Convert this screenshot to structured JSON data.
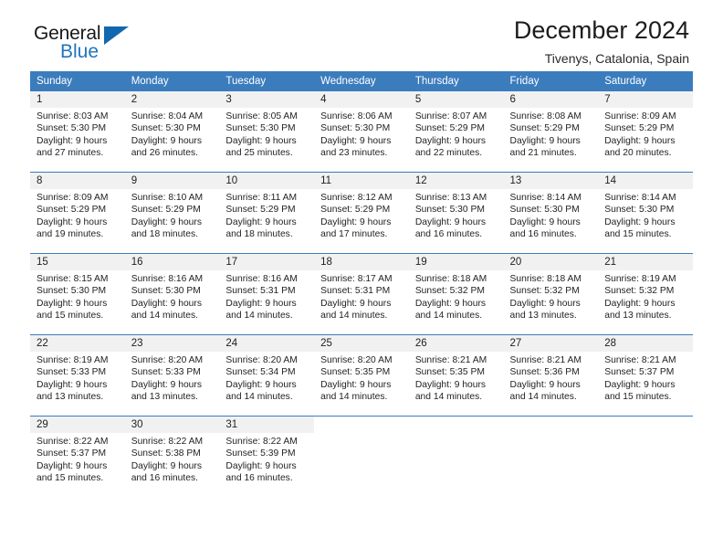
{
  "brand": {
    "name_part1": "General",
    "name_part2": "Blue",
    "triangle_color": "#1268ae",
    "blue_color": "#2175bb"
  },
  "header": {
    "title": "December 2024",
    "subtitle": "Tivenys, Catalonia, Spain"
  },
  "theme": {
    "header_row_bg": "#3b7cbd",
    "daynum_bg": "#f1f1f1",
    "text_color": "#232323"
  },
  "calendar": {
    "weekday_headers": [
      "Sunday",
      "Monday",
      "Tuesday",
      "Wednesday",
      "Thursday",
      "Friday",
      "Saturday"
    ],
    "weeks": [
      [
        {
          "day": "1",
          "sunrise": "Sunrise: 8:03 AM",
          "sunset": "Sunset: 5:30 PM",
          "daylight1": "Daylight: 9 hours",
          "daylight2": "and 27 minutes."
        },
        {
          "day": "2",
          "sunrise": "Sunrise: 8:04 AM",
          "sunset": "Sunset: 5:30 PM",
          "daylight1": "Daylight: 9 hours",
          "daylight2": "and 26 minutes."
        },
        {
          "day": "3",
          "sunrise": "Sunrise: 8:05 AM",
          "sunset": "Sunset: 5:30 PM",
          "daylight1": "Daylight: 9 hours",
          "daylight2": "and 25 minutes."
        },
        {
          "day": "4",
          "sunrise": "Sunrise: 8:06 AM",
          "sunset": "Sunset: 5:30 PM",
          "daylight1": "Daylight: 9 hours",
          "daylight2": "and 23 minutes."
        },
        {
          "day": "5",
          "sunrise": "Sunrise: 8:07 AM",
          "sunset": "Sunset: 5:29 PM",
          "daylight1": "Daylight: 9 hours",
          "daylight2": "and 22 minutes."
        },
        {
          "day": "6",
          "sunrise": "Sunrise: 8:08 AM",
          "sunset": "Sunset: 5:29 PM",
          "daylight1": "Daylight: 9 hours",
          "daylight2": "and 21 minutes."
        },
        {
          "day": "7",
          "sunrise": "Sunrise: 8:09 AM",
          "sunset": "Sunset: 5:29 PM",
          "daylight1": "Daylight: 9 hours",
          "daylight2": "and 20 minutes."
        }
      ],
      [
        {
          "day": "8",
          "sunrise": "Sunrise: 8:09 AM",
          "sunset": "Sunset: 5:29 PM",
          "daylight1": "Daylight: 9 hours",
          "daylight2": "and 19 minutes."
        },
        {
          "day": "9",
          "sunrise": "Sunrise: 8:10 AM",
          "sunset": "Sunset: 5:29 PM",
          "daylight1": "Daylight: 9 hours",
          "daylight2": "and 18 minutes."
        },
        {
          "day": "10",
          "sunrise": "Sunrise: 8:11 AM",
          "sunset": "Sunset: 5:29 PM",
          "daylight1": "Daylight: 9 hours",
          "daylight2": "and 18 minutes."
        },
        {
          "day": "11",
          "sunrise": "Sunrise: 8:12 AM",
          "sunset": "Sunset: 5:29 PM",
          "daylight1": "Daylight: 9 hours",
          "daylight2": "and 17 minutes."
        },
        {
          "day": "12",
          "sunrise": "Sunrise: 8:13 AM",
          "sunset": "Sunset: 5:30 PM",
          "daylight1": "Daylight: 9 hours",
          "daylight2": "and 16 minutes."
        },
        {
          "day": "13",
          "sunrise": "Sunrise: 8:14 AM",
          "sunset": "Sunset: 5:30 PM",
          "daylight1": "Daylight: 9 hours",
          "daylight2": "and 16 minutes."
        },
        {
          "day": "14",
          "sunrise": "Sunrise: 8:14 AM",
          "sunset": "Sunset: 5:30 PM",
          "daylight1": "Daylight: 9 hours",
          "daylight2": "and 15 minutes."
        }
      ],
      [
        {
          "day": "15",
          "sunrise": "Sunrise: 8:15 AM",
          "sunset": "Sunset: 5:30 PM",
          "daylight1": "Daylight: 9 hours",
          "daylight2": "and 15 minutes."
        },
        {
          "day": "16",
          "sunrise": "Sunrise: 8:16 AM",
          "sunset": "Sunset: 5:30 PM",
          "daylight1": "Daylight: 9 hours",
          "daylight2": "and 14 minutes."
        },
        {
          "day": "17",
          "sunrise": "Sunrise: 8:16 AM",
          "sunset": "Sunset: 5:31 PM",
          "daylight1": "Daylight: 9 hours",
          "daylight2": "and 14 minutes."
        },
        {
          "day": "18",
          "sunrise": "Sunrise: 8:17 AM",
          "sunset": "Sunset: 5:31 PM",
          "daylight1": "Daylight: 9 hours",
          "daylight2": "and 14 minutes."
        },
        {
          "day": "19",
          "sunrise": "Sunrise: 8:18 AM",
          "sunset": "Sunset: 5:32 PM",
          "daylight1": "Daylight: 9 hours",
          "daylight2": "and 14 minutes."
        },
        {
          "day": "20",
          "sunrise": "Sunrise: 8:18 AM",
          "sunset": "Sunset: 5:32 PM",
          "daylight1": "Daylight: 9 hours",
          "daylight2": "and 13 minutes."
        },
        {
          "day": "21",
          "sunrise": "Sunrise: 8:19 AM",
          "sunset": "Sunset: 5:32 PM",
          "daylight1": "Daylight: 9 hours",
          "daylight2": "and 13 minutes."
        }
      ],
      [
        {
          "day": "22",
          "sunrise": "Sunrise: 8:19 AM",
          "sunset": "Sunset: 5:33 PM",
          "daylight1": "Daylight: 9 hours",
          "daylight2": "and 13 minutes."
        },
        {
          "day": "23",
          "sunrise": "Sunrise: 8:20 AM",
          "sunset": "Sunset: 5:33 PM",
          "daylight1": "Daylight: 9 hours",
          "daylight2": "and 13 minutes."
        },
        {
          "day": "24",
          "sunrise": "Sunrise: 8:20 AM",
          "sunset": "Sunset: 5:34 PM",
          "daylight1": "Daylight: 9 hours",
          "daylight2": "and 14 minutes."
        },
        {
          "day": "25",
          "sunrise": "Sunrise: 8:20 AM",
          "sunset": "Sunset: 5:35 PM",
          "daylight1": "Daylight: 9 hours",
          "daylight2": "and 14 minutes."
        },
        {
          "day": "26",
          "sunrise": "Sunrise: 8:21 AM",
          "sunset": "Sunset: 5:35 PM",
          "daylight1": "Daylight: 9 hours",
          "daylight2": "and 14 minutes."
        },
        {
          "day": "27",
          "sunrise": "Sunrise: 8:21 AM",
          "sunset": "Sunset: 5:36 PM",
          "daylight1": "Daylight: 9 hours",
          "daylight2": "and 14 minutes."
        },
        {
          "day": "28",
          "sunrise": "Sunrise: 8:21 AM",
          "sunset": "Sunset: 5:37 PM",
          "daylight1": "Daylight: 9 hours",
          "daylight2": "and 15 minutes."
        }
      ],
      [
        {
          "day": "29",
          "sunrise": "Sunrise: 8:22 AM",
          "sunset": "Sunset: 5:37 PM",
          "daylight1": "Daylight: 9 hours",
          "daylight2": "and 15 minutes."
        },
        {
          "day": "30",
          "sunrise": "Sunrise: 8:22 AM",
          "sunset": "Sunset: 5:38 PM",
          "daylight1": "Daylight: 9 hours",
          "daylight2": "and 16 minutes."
        },
        {
          "day": "31",
          "sunrise": "Sunrise: 8:22 AM",
          "sunset": "Sunset: 5:39 PM",
          "daylight1": "Daylight: 9 hours",
          "daylight2": "and 16 minutes."
        },
        {
          "day": "",
          "sunrise": "",
          "sunset": "",
          "daylight1": "",
          "daylight2": ""
        },
        {
          "day": "",
          "sunrise": "",
          "sunset": "",
          "daylight1": "",
          "daylight2": ""
        },
        {
          "day": "",
          "sunrise": "",
          "sunset": "",
          "daylight1": "",
          "daylight2": ""
        },
        {
          "day": "",
          "sunrise": "",
          "sunset": "",
          "daylight1": "",
          "daylight2": ""
        }
      ]
    ]
  }
}
